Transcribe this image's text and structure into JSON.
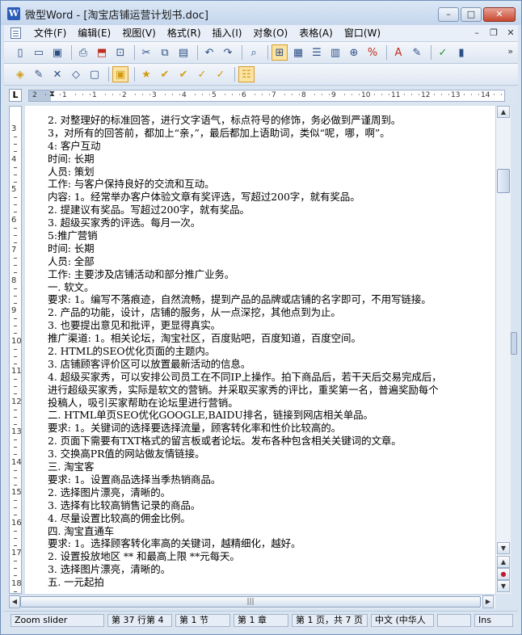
{
  "window": {
    "title": "微型Word - [淘宝店铺运营计划书.doc]",
    "app_icon": "W",
    "buttons": {
      "minimize": "–",
      "maximize": "□",
      "close": "✕"
    }
  },
  "menu": {
    "items": [
      "文件(F)",
      "编辑(E)",
      "视图(V)",
      "格式(R)",
      "插入(I)",
      "对象(O)",
      "表格(A)",
      "窗口(W)"
    ],
    "mdi": {
      "minimize": "–",
      "restore": "❐",
      "close": "✕"
    }
  },
  "toolbar1": {
    "icons": [
      "new-document-icon",
      "open-folder-icon",
      "save-icon",
      "sep",
      "print-icon",
      "pdf-icon",
      "print-preview-icon",
      "sep",
      "cut-icon",
      "copy-icon",
      "paste-icon",
      "sep",
      "undo-icon",
      "redo-icon",
      "sep",
      "find-icon",
      "sep",
      "ruler-toggle-icon",
      "page-view-icon",
      "outline-view-icon",
      "web-view-icon",
      "zoom-icon",
      "percent-icon",
      "sep",
      "font-color-icon",
      "highlight-icon",
      "sep",
      "spellcheck-icon",
      "chart-icon"
    ],
    "overflow": "»"
  },
  "toolbar2": {
    "icons": [
      "shape-icon",
      "edit-icon",
      "delete-icon",
      "copy-shape-icon",
      "paste-shape-icon",
      "sep",
      "object-icon",
      "sep",
      "star-icon",
      "check-icon",
      "check-alt-icon",
      "check-outline-icon",
      "check-outline2-icon",
      "sep",
      "properties-icon"
    ]
  },
  "ruler": {
    "corner": "L",
    "ticks": [
      "2",
      "1",
      "1",
      "2",
      "3",
      "4",
      "5",
      "6",
      "7",
      "8",
      "9",
      "10",
      "11",
      "12",
      "13",
      "14"
    ]
  },
  "vruler": {
    "numbers": [
      "3",
      "4",
      "5",
      "6",
      "7",
      "8",
      "9",
      "10",
      "11",
      "12",
      "13",
      "14",
      "15",
      "16",
      "17",
      "18"
    ]
  },
  "document": {
    "lines": [
      "2. 对整理好的标准回答，进行文字语气，标点符号的修饰，务必做到严谨周到。",
      "3，对所有的回答前，都加上“亲，”，最后都加上语助词，类似“呢，哪，啊”。",
      "4: 客户互动",
      "时间: 长期",
      "人员: 策划",
      "工作: 与客户保持良好的交流和互动。",
      "内容: 1。经常举办客户体验文章有奖评选，写超过200字，就有奖品。",
      "2. 提建议有奖品。写超过200字，就有奖品。",
      "3. 超级买家秀的评选。每月一次。",
      "5:推广营销",
      "时间: 长期",
      "人员: 全部",
      "工作: 主要涉及店铺活动和部分推广业务。",
      "一. 软文。",
      "要求: 1。编写不落痕迹，自然流畅，提到产品的品牌或店铺的名字即可，不用写链接。",
      "2. 产品的功能，设计，店铺的服务，从一点深挖，其他点到为止。",
      "3. 也要提出意见和批评，更显得真实。",
      "推广渠道: 1。相关论坛，淘宝社区，百度贴吧，百度知道，百度空间。",
      "2. HTML的SEO优化页面的主题内。",
      "3. 店铺顾客评价区可以放置最新活动的信息。",
      "4. 超级买家秀，可以安排公司员工在不同IP上操作。拍下商品后，若干天后交易完成后，",
      "进行超级买家秀，实际是软文的营销。并采取买家秀的评比，重奖第一名，普遍奖励每个",
      "投稿人，吸引买家帮助在论坛里进行营销。",
      "二. HTML单页SEO优化GOOGLE,BAIDU排名，链接到网店相关单品。",
      "要求: 1。关键词的选择要选择流量，顾客转化率和性价比较高的。",
      "2. 页面下需要有TXT格式的留言板或者论坛。发布各种包含相关关键词的文章。",
      "3. 交换高PR值的网站做友情链接。",
      "三. 淘宝客",
      "要求: 1。设置商品选择当季热销商品。",
      "2. 选择图片漂亮，清晰的。",
      "3. 选择有比较高销售记录的商品。",
      "4. 尽量设置比较高的佣金比例。",
      "四. 淘宝直通车",
      "要求: 1。选择顾客转化率高的关键词，越精细化，越好。",
      "2. 设置投放地区 ** 和最高上限 **元每天。",
      "3. 选择图片漂亮，清晰的。",
      "五. 一元起拍"
    ]
  },
  "scrollbar": {
    "up": "▲",
    "down": "▼",
    "prev_page": "▲",
    "browse_object": "●",
    "next_page": "▼",
    "thumb_grip": "≡",
    "h_left": "◀",
    "h_right": "▶",
    "h_grip": "|||"
  },
  "status": {
    "hint": "Zoom slider",
    "line_col": "第 37 行第 4",
    "section": "第 1 节",
    "chapter": "第 1 章",
    "page": "第 1 页，共 7 页",
    "language": "中文 (中华人",
    "mode": "Ins"
  }
}
